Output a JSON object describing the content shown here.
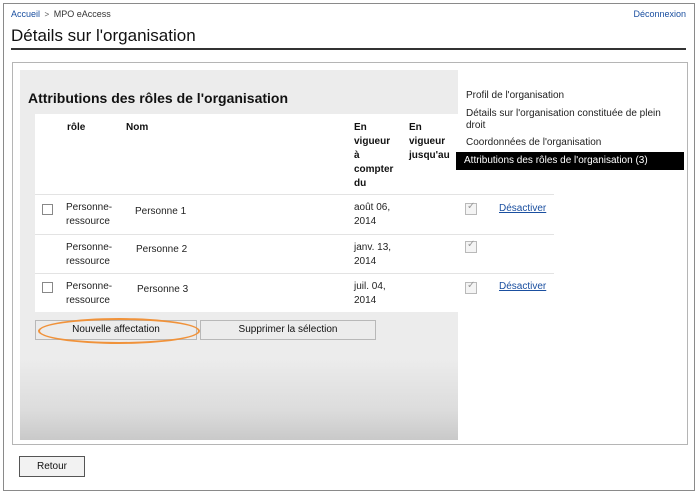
{
  "breadcrumb": {
    "home": "Accueil",
    "separator": ">",
    "current": "MPO eAccess"
  },
  "header": {
    "logout": "Déconnexion",
    "title": "Détails sur l'organisation"
  },
  "section": {
    "title": "Attributions des rôles de l'organisation"
  },
  "table": {
    "headers": {
      "role": "rôle",
      "name": "Nom",
      "start": [
        "En",
        "vigueur",
        "à",
        "compter",
        "du"
      ],
      "end": [
        "En",
        "vigueur",
        "jusqu'au"
      ]
    },
    "rows": [
      {
        "role": [
          "Personne-",
          "ressource"
        ],
        "name": "Personne 1",
        "start": [
          "août 06,",
          "2014"
        ],
        "action": "Désactiver",
        "selectable": true
      },
      {
        "role": [
          "Personne-",
          "ressource"
        ],
        "name": "Personne 2",
        "start": [
          "janv. 13,",
          "2014"
        ],
        "action": "",
        "selectable": false
      },
      {
        "role": [
          "Personne-",
          "ressource"
        ],
        "name": "Personne 3",
        "start": [
          "juil. 04,",
          "2014"
        ],
        "action": "Désactiver",
        "selectable": true
      }
    ]
  },
  "actions": {
    "new_assignment": "Nouvelle affectation",
    "delete_selection": "Supprimer la sélection"
  },
  "side_nav": {
    "items": [
      "Profil de l'organisation",
      "Détails sur l'organisation constituée de plein droit",
      "Coordonnées de l'organisation",
      "Attributions des rôles de l'organisation (3)"
    ],
    "active_index": 3
  },
  "footer": {
    "back": "Retour"
  },
  "colors": {
    "link": "#1a4fa0",
    "highlight": "#f0923a",
    "active_nav_bg": "#000000"
  }
}
